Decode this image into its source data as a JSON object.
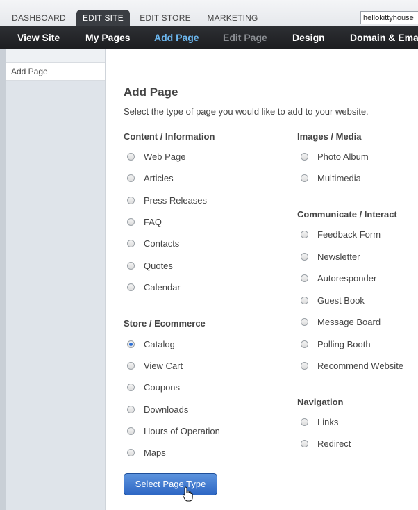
{
  "top_tabs": [
    {
      "label": "DASHBOARD",
      "active": false
    },
    {
      "label": "EDIT SITE",
      "active": true
    },
    {
      "label": "EDIT STORE",
      "active": false
    },
    {
      "label": "MARKETING",
      "active": false
    }
  ],
  "site_input": {
    "value": "hellokittyhouse"
  },
  "nav": [
    {
      "label": "View Site",
      "state": "normal"
    },
    {
      "label": "My Pages",
      "state": "normal"
    },
    {
      "label": "Add Page",
      "state": "current"
    },
    {
      "label": "Edit Page",
      "state": "disabled"
    },
    {
      "label": "Design",
      "state": "normal"
    },
    {
      "label": "Domain & Emai",
      "state": "normal"
    }
  ],
  "sidebar": {
    "items": [
      {
        "label": "Add Page"
      }
    ]
  },
  "main": {
    "title": "Add Page",
    "subtitle": "Select the type of page you would like to add to your website.",
    "sections": [
      {
        "title": "Content / Information",
        "options": [
          "Web Page",
          "Articles",
          "Press Releases",
          "FAQ",
          "Contacts",
          "Quotes",
          "Calendar"
        ]
      },
      {
        "title": "Store / Ecommerce",
        "options": [
          "Catalog",
          "View Cart",
          "Coupons",
          "Downloads",
          "Hours of Operation",
          "Maps"
        ]
      },
      {
        "title": "Images / Media",
        "options": [
          "Photo Album",
          "Multimedia"
        ]
      },
      {
        "title": "Communicate / Interact",
        "options": [
          "Feedback Form",
          "Newsletter",
          "Autoresponder",
          "Guest Book",
          "Message Board",
          "Polling Booth",
          "Recommend Website"
        ]
      },
      {
        "title": "Navigation",
        "options": [
          "Links",
          "Redirect"
        ]
      }
    ],
    "selected_option": "Catalog",
    "submit_label": "Select Page Type"
  },
  "colors": {
    "accent": "#6cb7ef",
    "button": "#3a72c8",
    "navbar": "#222427"
  }
}
